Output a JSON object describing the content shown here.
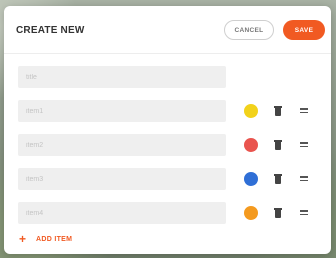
{
  "dialog": {
    "title": "CREATE NEW",
    "cancel_label": "CANCEL",
    "save_label": "SAVE"
  },
  "title_field": {
    "value": "",
    "placeholder": "title"
  },
  "items": [
    {
      "value": "",
      "placeholder": "item1",
      "color": "#f2d21b"
    },
    {
      "value": "",
      "placeholder": "item2",
      "color": "#e9544e"
    },
    {
      "value": "",
      "placeholder": "item3",
      "color": "#2f6fd6"
    },
    {
      "value": "",
      "placeholder": "item4",
      "color": "#f49a1f"
    }
  ],
  "add_item_label": "ADD ITEM",
  "colors": {
    "accent": "#f15a22",
    "field_bg": "#efefef"
  },
  "icons": {
    "add": "plus-icon",
    "delete": "trash-icon",
    "reorder": "drag-handle-icon"
  }
}
